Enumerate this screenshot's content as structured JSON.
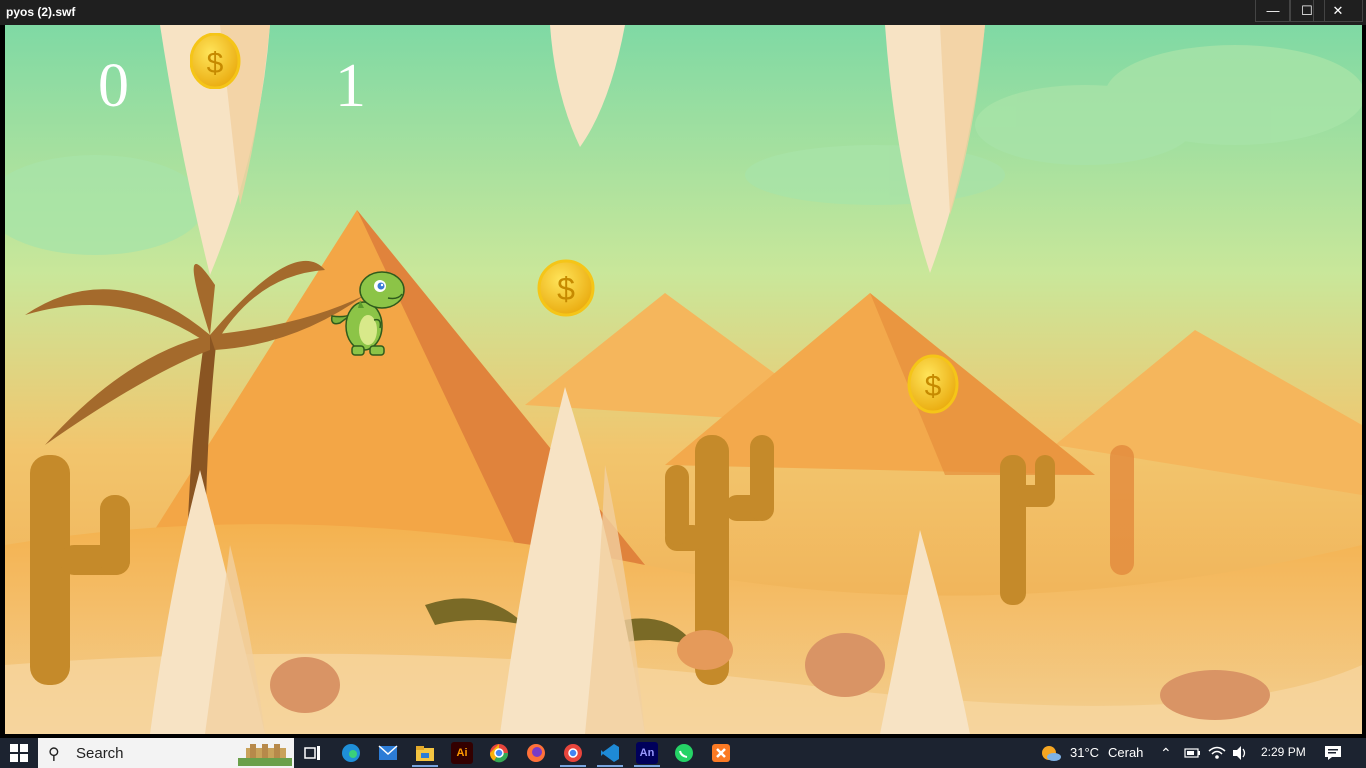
{
  "window": {
    "title": "pyos (2).swf",
    "minimize_icon": "minimize-icon",
    "maximize_icon": "maximize-icon",
    "close_icon": "close-icon",
    "min_glyph": "—",
    "max_glyph": "☐",
    "close_glyph": "✕"
  },
  "game": {
    "coins_collected": "0",
    "score": "1",
    "coin_symbol": "$"
  },
  "taskbar": {
    "search_placeholder": "Search",
    "weather_temp": "31°C",
    "weather_desc": "Cerah",
    "time": "2:29 PM",
    "apps": [
      "task-view",
      "edge",
      "mail",
      "file-explorer",
      "illustrator",
      "chrome",
      "firefox",
      "chrome-profile",
      "vscode",
      "animate",
      "whatsapp",
      "xampp"
    ],
    "ai_label": "Ai",
    "an_label": "An"
  }
}
